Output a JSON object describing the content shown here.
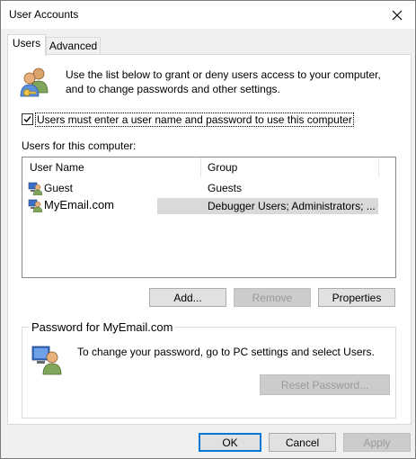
{
  "window": {
    "title": "User Accounts"
  },
  "tabs": [
    {
      "label": "Users",
      "active": true
    },
    {
      "label": "Advanced",
      "active": false
    }
  ],
  "users_tab": {
    "intro_line1": "Use the list below to grant or deny users access to your computer,",
    "intro_line2": "and to change passwords and other settings.",
    "require_password_checkbox": {
      "label": "Users must enter a user name and password to use this computer",
      "checked": true
    },
    "list_label": "Users for this computer:",
    "columns": [
      "User Name",
      "Group"
    ],
    "users": [
      {
        "name": "Guest",
        "group": "Guests",
        "selected": false
      },
      {
        "name": "MyEmail.com",
        "group": "Debugger Users; Administrators; ...",
        "selected": true
      }
    ],
    "buttons": {
      "add": "Add...",
      "remove": "Remove",
      "properties": "Properties"
    },
    "password_group": {
      "title": "Password for MyEmail.com",
      "text": "To change your password, go to PC settings and select Users.",
      "reset_button": "Reset Password..."
    }
  },
  "dialog_buttons": {
    "ok": "OK",
    "cancel": "Cancel",
    "apply": "Apply"
  },
  "colors": {
    "accent": "#0078d7",
    "selection": "#d9d9d9",
    "disabled_text": "#9a9a9a"
  },
  "icons": [
    "users-icon",
    "close-icon",
    "user-icon",
    "checkbox-checked-icon"
  ]
}
